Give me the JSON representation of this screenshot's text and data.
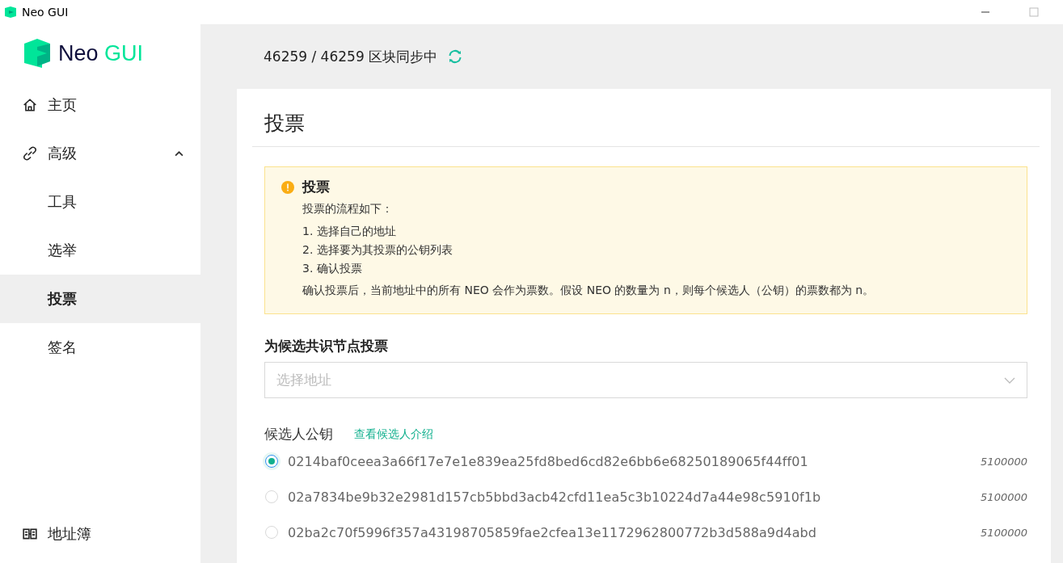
{
  "window": {
    "title": "Neo GUI"
  },
  "logo": {
    "first": "Neo",
    "second": "GUI"
  },
  "sidebar": {
    "items": [
      {
        "label": "主页",
        "selected": false
      },
      {
        "label": "高级",
        "selected": false,
        "expanded": true,
        "children": [
          {
            "label": "工具",
            "selected": false
          },
          {
            "label": "选举",
            "selected": false
          },
          {
            "label": "投票",
            "selected": true
          },
          {
            "label": "签名",
            "selected": false
          }
        ]
      }
    ],
    "footer_item": {
      "label": "地址簿",
      "selected": false
    }
  },
  "sync_status": "46259 / 46259 区块同步中",
  "card": {
    "title": "投票",
    "alert": {
      "title": "投票",
      "intro": "投票的流程如下：",
      "steps": [
        "1. 选择自己的地址",
        "2. 选择要为其投票的公钥列表",
        "3. 确认投票"
      ],
      "note": "确认投票后，当前地址中的所有 NEO 会作为票数。假设 NEO 的数量为 n，则每个候选人（公钥）的票数都为 n。"
    },
    "section_title": "为候选共识节点投票",
    "address_select": {
      "placeholder": "选择地址"
    },
    "candidates": {
      "label": "候选人公钥",
      "link": "查看候选人介绍",
      "items": [
        {
          "key": "0214baf0ceea3a66f17e7e1e839ea25fd8bed6cd82e6bb6e68250189065f44ff01",
          "votes": "5100000",
          "selected": true
        },
        {
          "key": "02a7834be9b32e2981d157cb5bbd3acb42cfd11ea5c3b10224d7a44e98c5910f1b",
          "votes": "5100000",
          "selected": false
        },
        {
          "key": "02ba2c70f5996f357a43198705859fae2cfea13e1172962800772b3d588a9d4abd",
          "votes": "5100000",
          "selected": false
        }
      ]
    }
  }
}
